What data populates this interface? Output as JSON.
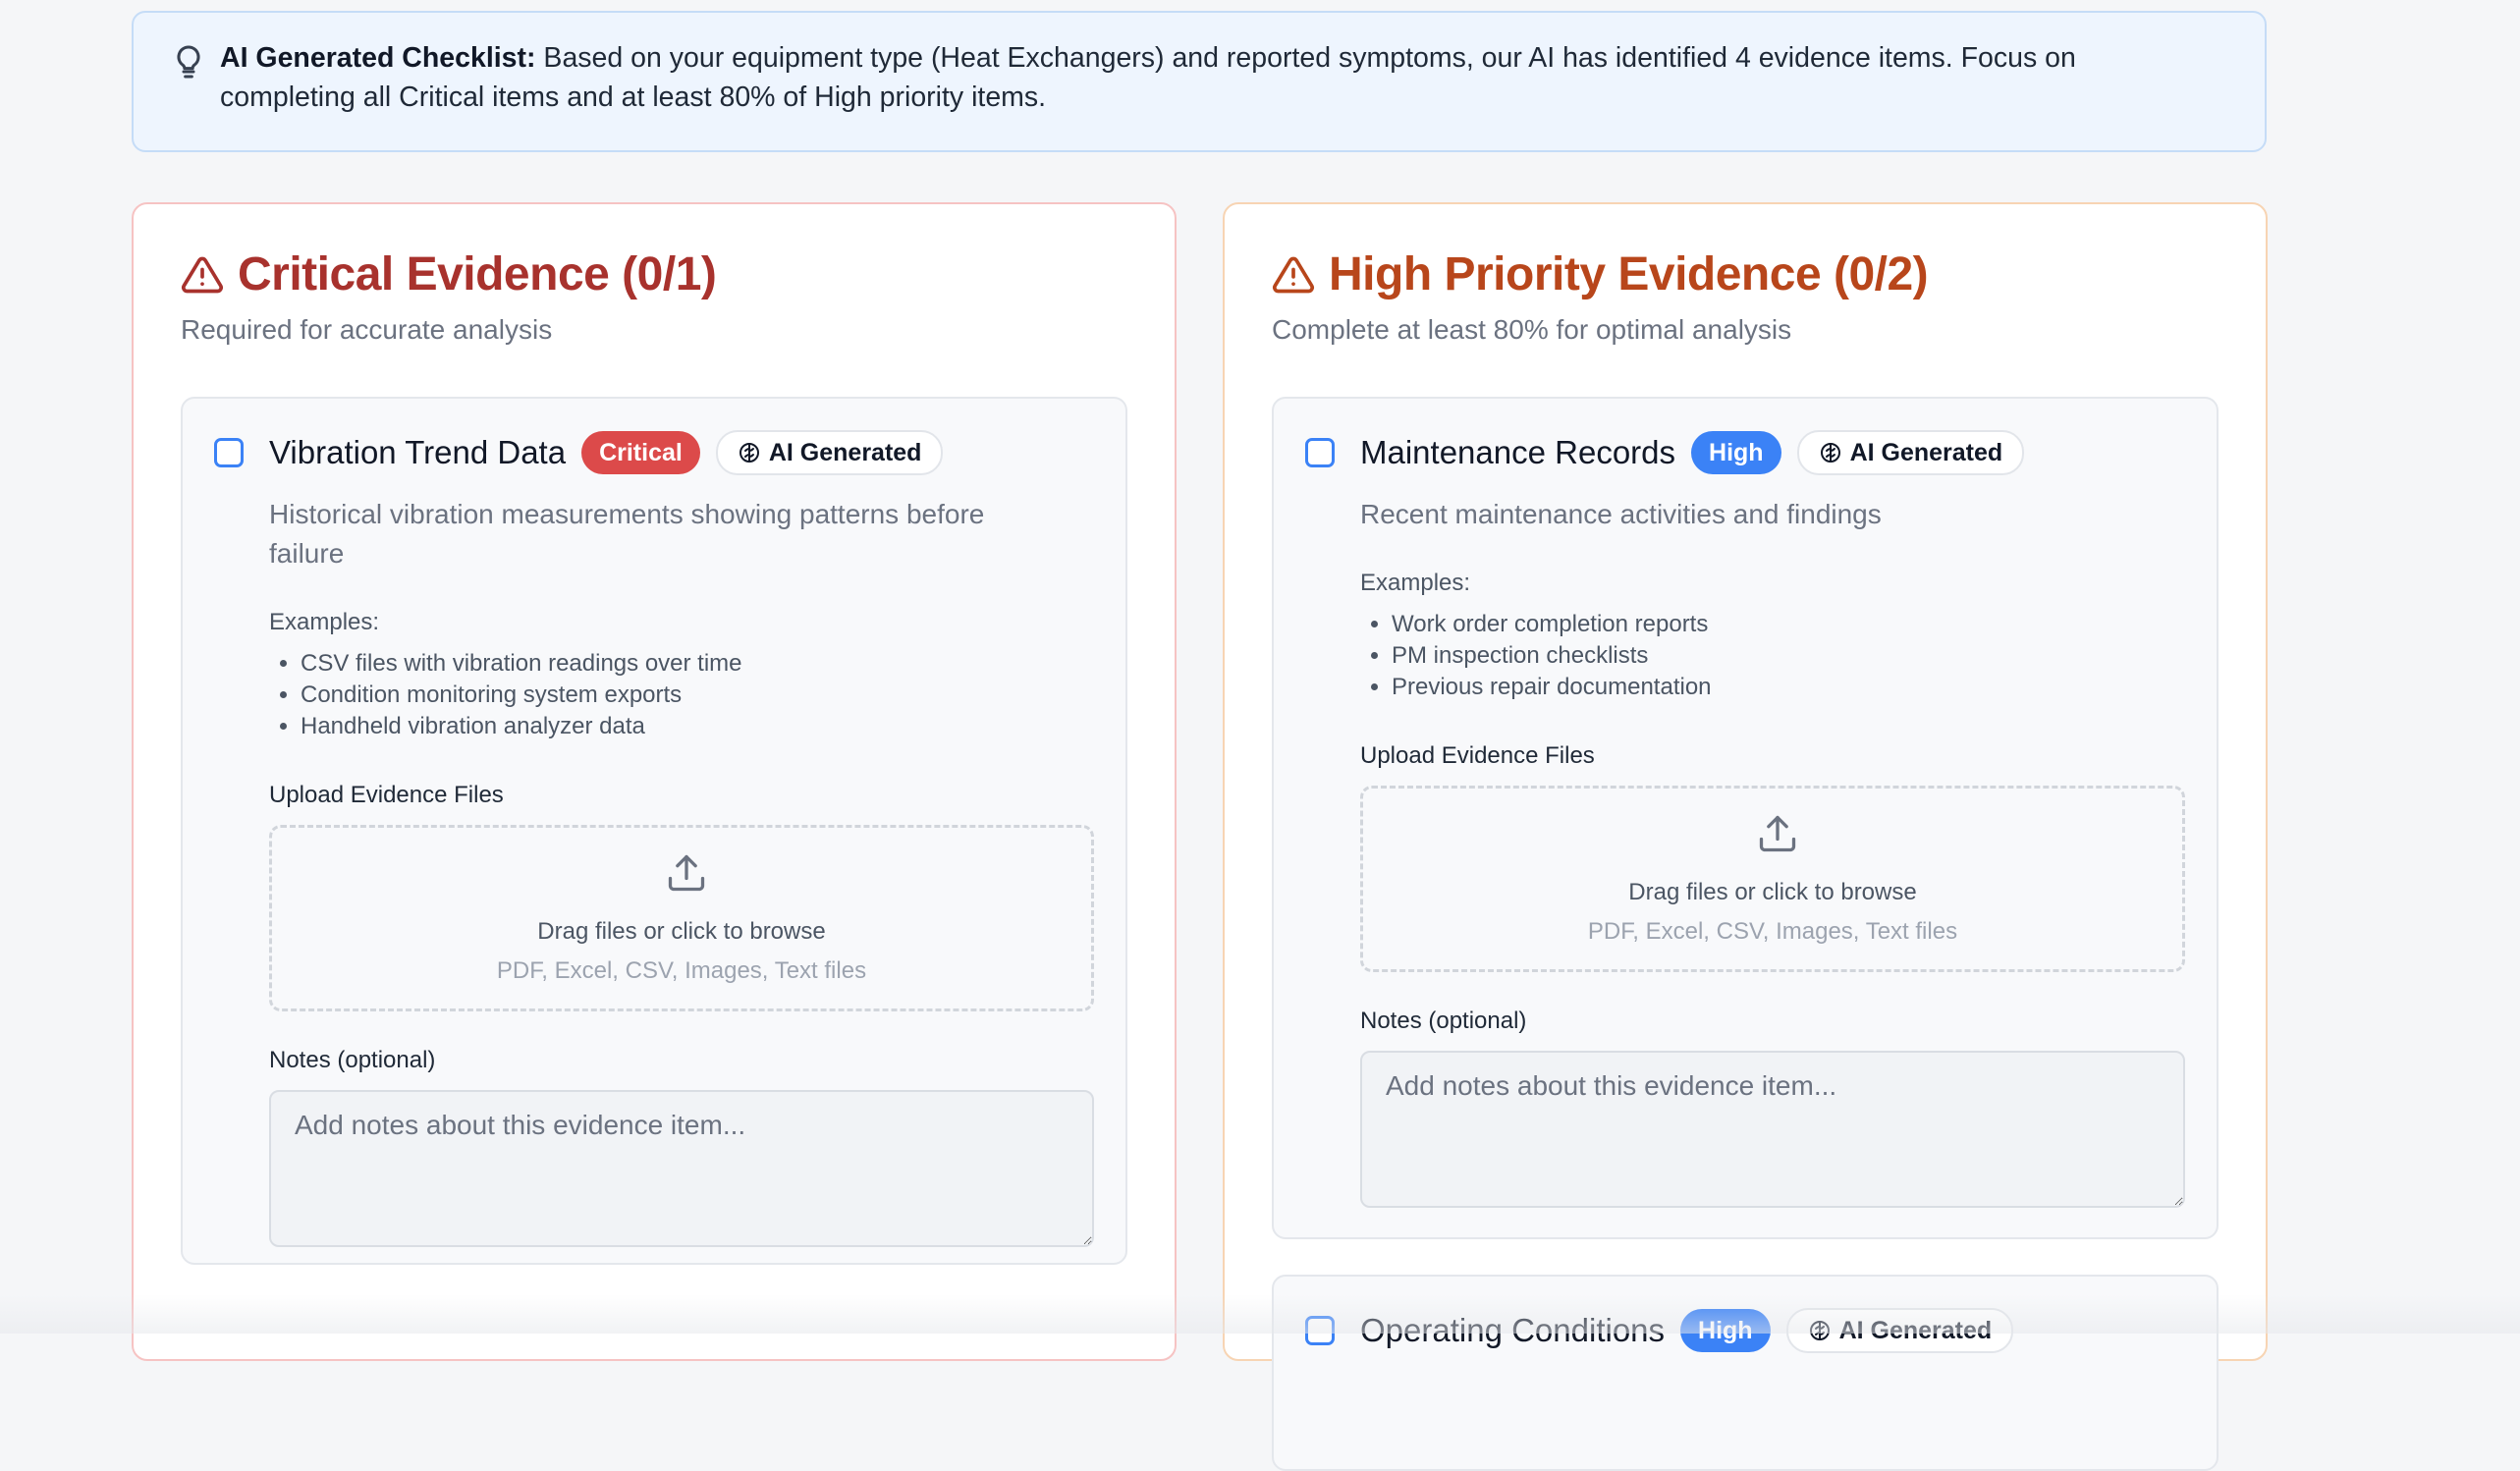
{
  "banner": {
    "label": "AI Generated Checklist:",
    "text": " Based on your equipment type (Heat Exchangers) and reported symptoms, our AI has identified 4 evidence items. Focus on completing all Critical items and at least 80% of High priority items."
  },
  "critical": {
    "title": "Critical Evidence (0/1)",
    "subtitle": "Required for accurate analysis",
    "items": [
      {
        "title": "Vibration Trend Data",
        "badge": "Critical",
        "ai_badge": "AI Generated",
        "description": "Historical vibration measurements showing patterns before failure",
        "examples_label": "Examples:",
        "examples": [
          "CSV files with vibration readings over time",
          "Condition monitoring system exports",
          "Handheld vibration analyzer data"
        ],
        "upload_label": "Upload Evidence Files",
        "dropzone_text": "Drag files or click to browse",
        "dropzone_types": "PDF, Excel, CSV, Images, Text files",
        "notes_label": "Notes (optional)",
        "notes_placeholder": "Add notes about this evidence item..."
      }
    ]
  },
  "high": {
    "title": "High Priority Evidence (0/2)",
    "subtitle": "Complete at least 80% for optimal analysis",
    "items": [
      {
        "title": "Maintenance Records",
        "badge": "High",
        "ai_badge": "AI Generated",
        "description": "Recent maintenance activities and findings",
        "examples_label": "Examples:",
        "examples": [
          "Work order completion reports",
          "PM inspection checklists",
          "Previous repair documentation"
        ],
        "upload_label": "Upload Evidence Files",
        "dropzone_text": "Drag files or click to browse",
        "dropzone_types": "PDF, Excel, CSV, Images, Text files",
        "notes_label": "Notes (optional)",
        "notes_placeholder": "Add notes about this evidence item..."
      },
      {
        "title": "Operating Conditions",
        "badge": "High",
        "ai_badge": "AI Generated"
      }
    ]
  },
  "icons": {
    "banner": "lightbulb-icon",
    "panel": "warning-triangle-icon",
    "ai_badge": "brain-icon",
    "dropzone": "upload-icon"
  },
  "colors": {
    "critical_title": "#a8322d",
    "high_title": "#b8461b",
    "critical_badge": "#dc4a4a",
    "high_badge": "#3b82f6",
    "checkbox": "#3b82f6",
    "banner_bg": "#eef5fe"
  }
}
